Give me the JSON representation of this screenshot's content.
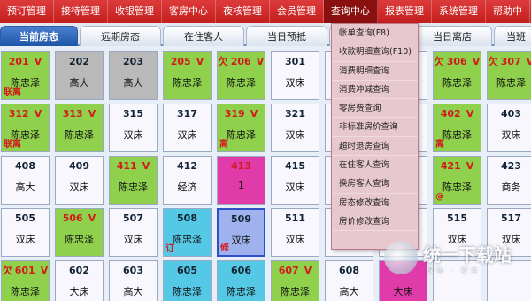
{
  "menubar": {
    "items": [
      "预订管理",
      "接待管理",
      "收银管理",
      "客房中心",
      "夜核管理",
      "会员管理",
      "查询中心",
      "报表管理",
      "系统管理",
      "帮助中"
    ],
    "active_index": 6
  },
  "tabs": [
    "当前房态",
    "远期房态",
    "在住客人",
    "当日预抵",
    "",
    "当日离店",
    "当班"
  ],
  "rooms": [
    {
      "no": "201",
      "prefix": "",
      "suffix": "V",
      "name": "陈忠泽",
      "tag": "联离",
      "color": "g"
    },
    {
      "no": "202",
      "prefix": "",
      "suffix": "",
      "name": "高大",
      "tag": "",
      "color": "gr"
    },
    {
      "no": "203",
      "prefix": "",
      "suffix": "",
      "name": "高大",
      "tag": "",
      "color": "gr"
    },
    {
      "no": "205",
      "prefix": "",
      "suffix": "V",
      "name": "陈忠泽",
      "tag": "",
      "color": "g"
    },
    {
      "no": "206",
      "prefix": "欠",
      "suffix": "V",
      "name": "陈忠泽",
      "tag": "",
      "color": "g"
    },
    {
      "no": "301",
      "prefix": "",
      "suffix": "",
      "name": "双床",
      "tag": "",
      "color": "w"
    },
    {
      "no": "",
      "prefix": "",
      "suffix": "",
      "name": "",
      "tag": "",
      "color": "w"
    },
    {
      "no": "",
      "prefix": "",
      "suffix": "",
      "name": "",
      "tag": "",
      "color": "w"
    },
    {
      "no": "306",
      "prefix": "欠",
      "suffix": "V",
      "name": "陈忠泽",
      "tag": "",
      "color": "g"
    },
    {
      "no": "307",
      "prefix": "欠",
      "suffix": "V",
      "name": "陈忠泽",
      "tag": "",
      "color": "g"
    },
    {
      "no": "312",
      "prefix": "",
      "suffix": "V",
      "name": "陈忠泽",
      "tag": "联离",
      "color": "g"
    },
    {
      "no": "313",
      "prefix": "",
      "suffix": "V",
      "name": "陈忠泽",
      "tag": "",
      "color": "g"
    },
    {
      "no": "315",
      "prefix": "",
      "suffix": "",
      "name": "双床",
      "tag": "",
      "color": "w"
    },
    {
      "no": "317",
      "prefix": "",
      "suffix": "",
      "name": "双床",
      "tag": "",
      "color": "w"
    },
    {
      "no": "319",
      "prefix": "",
      "suffix": "V",
      "name": "陈忠泽",
      "tag": "离",
      "color": "g"
    },
    {
      "no": "321",
      "prefix": "",
      "suffix": "",
      "name": "双床",
      "tag": "",
      "color": "w"
    },
    {
      "no": "",
      "prefix": "",
      "suffix": "",
      "name": "",
      "tag": "",
      "color": "w"
    },
    {
      "no": "",
      "prefix": "",
      "suffix": "",
      "name": "",
      "tag": "",
      "color": "w"
    },
    {
      "no": "402",
      "prefix": "",
      "suffix": "V",
      "name": "陈忠泽",
      "tag": "离",
      "color": "g"
    },
    {
      "no": "403",
      "prefix": "",
      "suffix": "",
      "name": "双床",
      "tag": "",
      "color": "w"
    },
    {
      "no": "408",
      "prefix": "",
      "suffix": "",
      "name": "高大",
      "tag": "",
      "color": "w"
    },
    {
      "no": "409",
      "prefix": "",
      "suffix": "",
      "name": "双床",
      "tag": "",
      "color": "w"
    },
    {
      "no": "411",
      "prefix": "",
      "suffix": "V",
      "name": "陈忠泽",
      "tag": "",
      "color": "g"
    },
    {
      "no": "412",
      "prefix": "",
      "suffix": "",
      "name": "经济",
      "tag": "",
      "color": "w"
    },
    {
      "no": "413",
      "prefix": "",
      "suffix": "",
      "name": "1",
      "tag": "",
      "color": "r"
    },
    {
      "no": "415",
      "prefix": "",
      "suffix": "",
      "name": "双床",
      "tag": "",
      "color": "w"
    },
    {
      "no": "",
      "prefix": "",
      "suffix": "",
      "name": "",
      "tag": "",
      "color": "w"
    },
    {
      "no": "",
      "prefix": "",
      "suffix": "",
      "name": "",
      "tag": "",
      "color": "w"
    },
    {
      "no": "421",
      "prefix": "",
      "suffix": "V",
      "name": "陈忠泽",
      "tag": "@",
      "color": "g"
    },
    {
      "no": "423",
      "prefix": "",
      "suffix": "",
      "name": "商务",
      "tag": "",
      "color": "w"
    },
    {
      "no": "505",
      "prefix": "",
      "suffix": "",
      "name": "双床",
      "tag": "",
      "color": "w"
    },
    {
      "no": "506",
      "prefix": "",
      "suffix": "V",
      "name": "陈忠泽",
      "tag": "",
      "color": "g"
    },
    {
      "no": "507",
      "prefix": "",
      "suffix": "",
      "name": "双床",
      "tag": "",
      "color": "w"
    },
    {
      "no": "508",
      "prefix": "",
      "suffix": "",
      "name": "陈忠泽",
      "tag": "订",
      "color": "c"
    },
    {
      "no": "509",
      "prefix": "",
      "suffix": "",
      "name": "双床",
      "tag": "修",
      "color": "p"
    },
    {
      "no": "511",
      "prefix": "",
      "suffix": "",
      "name": "双床",
      "tag": "",
      "color": "w"
    },
    {
      "no": "",
      "prefix": "",
      "suffix": "",
      "name": "",
      "tag": "",
      "color": "w"
    },
    {
      "no": "",
      "prefix": "",
      "suffix": "",
      "name": "",
      "tag": "",
      "color": "w"
    },
    {
      "no": "515",
      "prefix": "",
      "suffix": "",
      "name": "双床",
      "tag": "",
      "color": "w"
    },
    {
      "no": "517",
      "prefix": "",
      "suffix": "",
      "name": "双床",
      "tag": "",
      "color": "w"
    },
    {
      "no": "601",
      "prefix": "欠",
      "suffix": "V",
      "name": "陈忠泽",
      "tag": "",
      "color": "g"
    },
    {
      "no": "602",
      "prefix": "",
      "suffix": "",
      "name": "大床",
      "tag": "",
      "color": "w"
    },
    {
      "no": "603",
      "prefix": "",
      "suffix": "",
      "name": "高大",
      "tag": "",
      "color": "w"
    },
    {
      "no": "605",
      "prefix": "",
      "suffix": "",
      "name": "陈忠泽",
      "tag": "",
      "color": "c"
    },
    {
      "no": "606",
      "prefix": "",
      "suffix": "",
      "name": "陈忠泽",
      "tag": "",
      "color": "c"
    },
    {
      "no": "607",
      "prefix": "",
      "suffix": "V",
      "name": "陈忠泽",
      "tag": "",
      "color": "g"
    },
    {
      "no": "608",
      "prefix": "",
      "suffix": "",
      "name": "高大",
      "tag": "",
      "color": "w"
    },
    {
      "no": "",
      "prefix": "",
      "suffix": "",
      "name": "大床",
      "tag": "",
      "color": "r"
    },
    {
      "no": "",
      "prefix": "",
      "suffix": "",
      "name": "",
      "tag": "",
      "color": "w"
    },
    {
      "no": "",
      "prefix": "",
      "suffix": "",
      "name": "",
      "tag": "",
      "color": "w"
    }
  ],
  "dropdown": {
    "items": [
      "帐单查询(F8)",
      "收款明细查询(F10)",
      "消费明细查询",
      "消费冲减查询",
      "零房费查询",
      "非标准房价查询",
      "超时退房查询",
      "在住客人查询",
      "换房客人查询",
      "房态修改查询",
      "房价修改查询"
    ]
  },
  "watermark": {
    "text": "统一下载站",
    "sub": "绿色 · 安全"
  }
}
